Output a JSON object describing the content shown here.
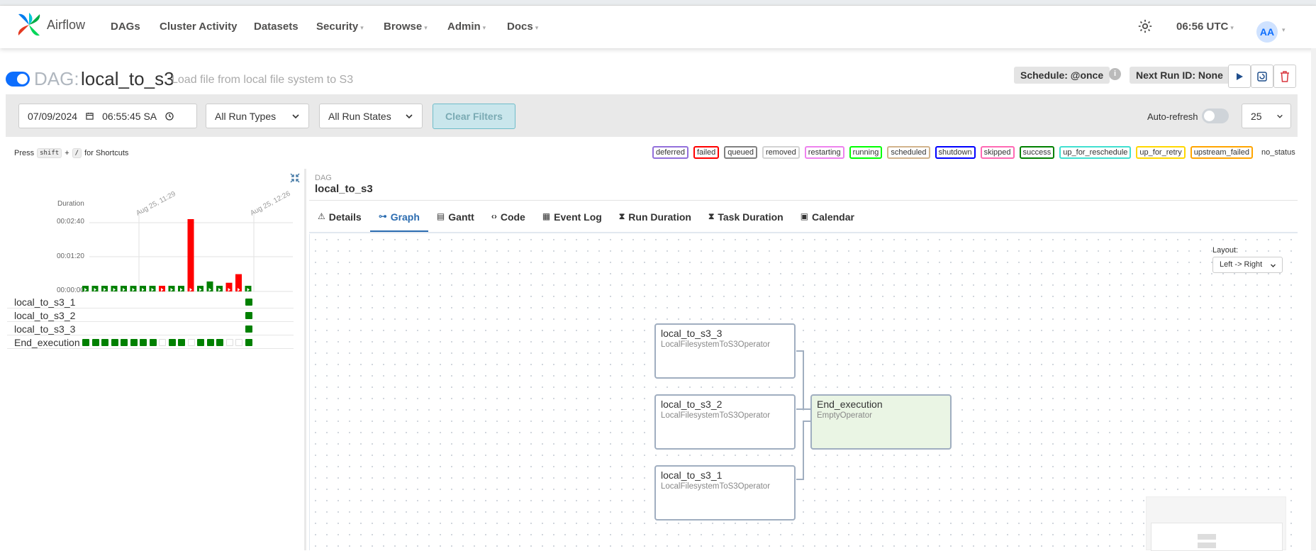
{
  "app": {
    "brand": "Airflow",
    "nav": [
      {
        "label": "DAGs",
        "has_caret": false
      },
      {
        "label": "Cluster Activity",
        "has_caret": false
      },
      {
        "label": "Datasets",
        "has_caret": false
      },
      {
        "label": "Security",
        "has_caret": true
      },
      {
        "label": "Browse",
        "has_caret": true
      },
      {
        "label": "Admin",
        "has_caret": true
      },
      {
        "label": "Docs",
        "has_caret": true
      }
    ],
    "time": "06:56 UTC",
    "avatar": "AA"
  },
  "dag": {
    "prefix": "DAG:",
    "name": "local_to_s3",
    "description": "Load file from local file system to S3",
    "schedule": "Schedule: @once",
    "next_run": "Next Run ID: None",
    "paused": false
  },
  "filters": {
    "date": "07/09/2024",
    "time": "06:55:45 SA",
    "run_types": "All Run Types",
    "run_states": "All Run States",
    "clear_label": "Clear Filters",
    "autorefresh_label": "Auto-refresh",
    "autorefresh_on": false,
    "num_runs": "25"
  },
  "shortcuts": {
    "press": "Press",
    "shift": "shift",
    "plus": "+",
    "slash": "/",
    "suffix": "for Shortcuts"
  },
  "legend": [
    {
      "label": "deferred",
      "color": "#9370db"
    },
    {
      "label": "failed",
      "color": "#ff0000"
    },
    {
      "label": "queued",
      "color": "#808080"
    },
    {
      "label": "removed",
      "color": "#d3d3d3"
    },
    {
      "label": "restarting",
      "color": "#ee82ee"
    },
    {
      "label": "running",
      "color": "#00ff00"
    },
    {
      "label": "scheduled",
      "color": "#d2b48c"
    },
    {
      "label": "shutdown",
      "color": "#0000ff"
    },
    {
      "label": "skipped",
      "color": "#ff69b4"
    },
    {
      "label": "success",
      "color": "#008000"
    },
    {
      "label": "up_for_reschedule",
      "color": "#40e0d0"
    },
    {
      "label": "up_for_retry",
      "color": "#ffd700"
    },
    {
      "label": "upstream_failed",
      "color": "#ffa500"
    },
    {
      "label": "no_status",
      "color": "transparent"
    }
  ],
  "grid": {
    "duration_label": "Duration",
    "ticks": [
      "00:02:40",
      "00:01:20",
      "00:00:00"
    ],
    "date_labels": [
      "Aug 25, 11:29",
      "Aug 25, 12:26"
    ],
    "runs": [
      {
        "duration_s": 4,
        "state": "success"
      },
      {
        "duration_s": 3,
        "state": "success"
      },
      {
        "duration_s": 3,
        "state": "success"
      },
      {
        "duration_s": 3,
        "state": "success"
      },
      {
        "duration_s": 3,
        "state": "success"
      },
      {
        "duration_s": 3,
        "state": "success"
      },
      {
        "duration_s": 3,
        "state": "success"
      },
      {
        "duration_s": 3,
        "state": "success"
      },
      {
        "duration_s": 3,
        "state": "failed"
      },
      {
        "duration_s": 3,
        "state": "success"
      },
      {
        "duration_s": 3,
        "state": "success"
      },
      {
        "duration_s": 160,
        "state": "failed"
      },
      {
        "duration_s": 3,
        "state": "success"
      },
      {
        "duration_s": 15,
        "state": "success"
      },
      {
        "duration_s": 4,
        "state": "success"
      },
      {
        "duration_s": 12,
        "state": "failed"
      },
      {
        "duration_s": 32,
        "state": "failed"
      },
      {
        "duration_s": 4,
        "state": "success"
      }
    ],
    "rows": [
      {
        "label": "local_to_s3_1",
        "cells": [
          "",
          "",
          "",
          "",
          "",
          "",
          "",
          "",
          "",
          "",
          "",
          "",
          "",
          "",
          "",
          "",
          "",
          "success"
        ]
      },
      {
        "label": "local_to_s3_2",
        "cells": [
          "",
          "",
          "",
          "",
          "",
          "",
          "",
          "",
          "",
          "",
          "",
          "",
          "",
          "",
          "",
          "",
          "",
          "success"
        ]
      },
      {
        "label": "local_to_s3_3",
        "cells": [
          "",
          "",
          "",
          "",
          "",
          "",
          "",
          "",
          "",
          "",
          "",
          "",
          "",
          "",
          "",
          "",
          "",
          "success"
        ]
      },
      {
        "label": "End_execution",
        "cells": [
          "success",
          "success",
          "success",
          "success",
          "success",
          "success",
          "success",
          "success",
          "none",
          "success",
          "success",
          "none",
          "success",
          "success",
          "success",
          "none",
          "none",
          "success"
        ]
      }
    ]
  },
  "pane": {
    "small_label": "DAG",
    "title": "local_to_s3",
    "tabs": [
      {
        "label": "Details",
        "icon": "warning-icon",
        "active": false
      },
      {
        "label": "Graph",
        "icon": "graph-icon",
        "active": true
      },
      {
        "label": "Gantt",
        "icon": "gantt-icon",
        "active": false
      },
      {
        "label": "Code",
        "icon": "code-icon",
        "active": false
      },
      {
        "label": "Event Log",
        "icon": "log-icon",
        "active": false
      },
      {
        "label": "Run Duration",
        "icon": "hourglass-icon",
        "active": false
      },
      {
        "label": "Task Duration",
        "icon": "hourglass-icon",
        "active": false
      },
      {
        "label": "Calendar",
        "icon": "calendar-icon",
        "active": false
      }
    ]
  },
  "graph": {
    "layout_label": "Layout:",
    "layout_value": "Left -> Right",
    "nodes": [
      {
        "id": "local_to_s3_3",
        "title": "local_to_s3_3",
        "operator": "LocalFilesystemToS3Operator"
      },
      {
        "id": "local_to_s3_2",
        "title": "local_to_s3_2",
        "operator": "LocalFilesystemToS3Operator"
      },
      {
        "id": "local_to_s3_1",
        "title": "local_to_s3_1",
        "operator": "LocalFilesystemToS3Operator"
      },
      {
        "id": "End_execution",
        "title": "End_execution",
        "operator": "EmptyOperator"
      }
    ]
  },
  "colors": {
    "success": "#008000",
    "failed": "#ff0000",
    "accent": "#0d6efd"
  }
}
